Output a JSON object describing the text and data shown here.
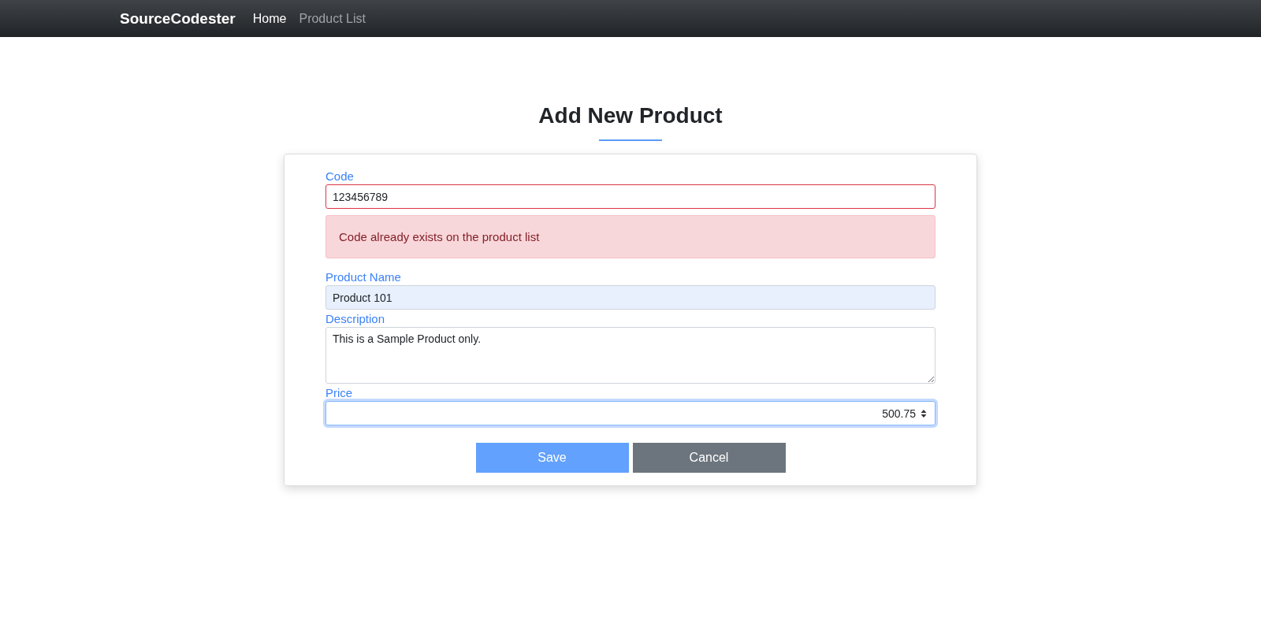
{
  "navbar": {
    "brand": "SourceCodester",
    "links": [
      {
        "label": "Home",
        "selected": true
      },
      {
        "label": "Product List",
        "selected": false
      }
    ]
  },
  "page": {
    "title": "Add New Product"
  },
  "form": {
    "fields": [
      {
        "label": "Code",
        "kind": "text",
        "value": "123456789",
        "invalid": true,
        "autofilled": false,
        "focused": false,
        "error": "Code already exists on the product list"
      },
      {
        "label": "Product Name",
        "kind": "text",
        "value": "Product 101",
        "invalid": false,
        "autofilled": true,
        "focused": false
      },
      {
        "label": "Description",
        "kind": "textarea",
        "value": "This is a Sample Product only.",
        "invalid": false,
        "autofilled": false,
        "focused": false
      },
      {
        "label": "Price",
        "kind": "number",
        "value": "500.75",
        "invalid": false,
        "autofilled": false,
        "focused": true
      }
    ],
    "buttons": [
      {
        "label": "Save",
        "kind": "primary"
      },
      {
        "label": "Cancel",
        "kind": "secondary"
      }
    ]
  }
}
